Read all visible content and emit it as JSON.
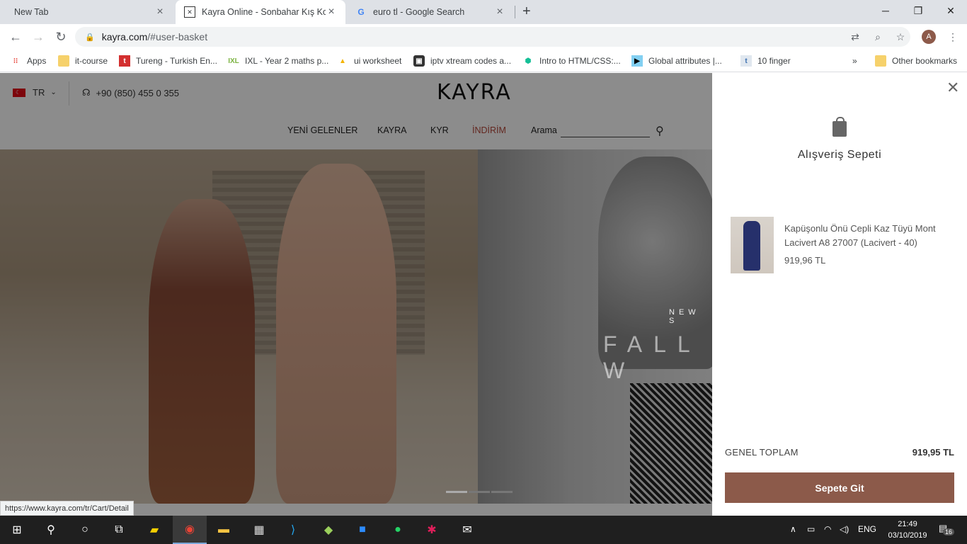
{
  "browser": {
    "tabs": [
      {
        "title": "New Tab",
        "active": false
      },
      {
        "title": "Kayra Online - Sonbahar Kış Kole",
        "active": true
      },
      {
        "title": "euro tl - Google Search",
        "active": false
      }
    ],
    "new_tab_symbol": "+",
    "url_host": "kayra.com",
    "url_path": "/#user-basket",
    "avatar_letter": "A",
    "bookmarks": [
      {
        "label": "Apps",
        "icon": "apps-grid-icon"
      },
      {
        "label": "it-course",
        "icon": "folder-icon"
      },
      {
        "label": "Tureng - Turkish En...",
        "icon": "tureng-icon"
      },
      {
        "label": "IXL - Year 2 maths p...",
        "icon": "ixl-icon"
      },
      {
        "label": "ui worksheet",
        "icon": "drive-icon"
      },
      {
        "label": "iptv xtream codes a...",
        "icon": "iptv-icon"
      },
      {
        "label": "Intro to HTML/CSS:...",
        "icon": "khan-icon"
      },
      {
        "label": "Global attributes |...",
        "icon": "mdn-icon"
      },
      {
        "label": "10 finger",
        "icon": "t-icon"
      }
    ],
    "bookmarks_overflow": "»",
    "other_bookmarks": "Other bookmarks",
    "status_url": "https://www.kayra.com/tr/Cart/Detail"
  },
  "site": {
    "language": "TR",
    "phone": "+90 (850) 455 0 355",
    "logo": "KAYRA",
    "nav": [
      {
        "label": "YENİ GELENLER",
        "color": "#222"
      },
      {
        "label": "KAYRA",
        "color": "#222"
      },
      {
        "label": "KYR",
        "color": "#222"
      },
      {
        "label": "İNDİRİM",
        "color": "#b5473a"
      },
      {
        "label": "Arama",
        "color": "#222"
      }
    ],
    "hero_small": "NEW S",
    "hero_large": "FALL W"
  },
  "cart": {
    "title": "Alışveriş Sepeti",
    "items": [
      {
        "name": "Kapüşonlu Önü Cepli Kaz Tüyü Mont Lacivert A8 27007 (Lacivert - 40)",
        "price": "919,96 TL"
      }
    ],
    "total_label": "GENEL TOPLAM",
    "total_value": "919,95 TL",
    "checkout_label": "Sepete Git",
    "accent": "#8c5a4a"
  },
  "taskbar": {
    "language": "ENG",
    "time": "21:49",
    "date": "03/10/2019",
    "notifications": "16"
  }
}
